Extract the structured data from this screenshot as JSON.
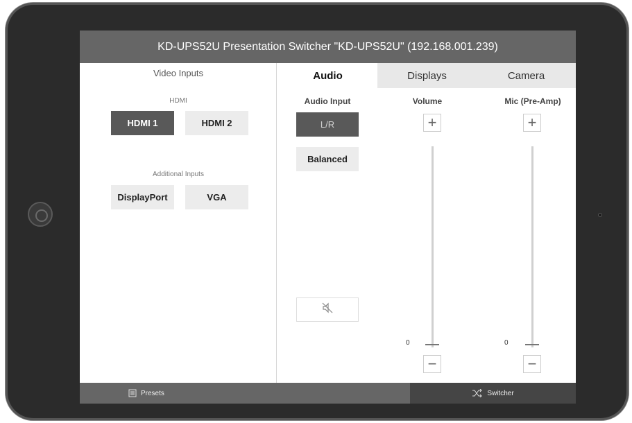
{
  "title": "KD-UPS52U Presentation Switcher \"KD-UPS52U\" (192.168.001.239)",
  "video_inputs": {
    "heading": "Video Inputs",
    "hdmi_label": "HDMI",
    "hdmi_buttons": [
      "HDMI 1",
      "HDMI 2"
    ],
    "additional_label": "Additional Inputs",
    "additional_buttons": [
      "DisplayPort",
      "VGA"
    ],
    "selected": "HDMI 1"
  },
  "tabs": [
    "Audio",
    "Displays",
    "Camera"
  ],
  "active_tab": "Audio",
  "audio": {
    "input_label": "Audio Input",
    "lr_label": "L/R",
    "balanced_label": "Balanced",
    "volume_label": "Volume",
    "mic_label": "Mic (Pre-Amp)",
    "volume_value": "0",
    "mic_value": "0",
    "volume_level": 0,
    "mic_level": 0
  },
  "footer": {
    "presets_label": "Presets",
    "switcher_label": "Switcher"
  },
  "icons": {
    "mute": "speaker-muted-icon",
    "presets": "presets-icon",
    "switcher": "shuffle-icon"
  }
}
